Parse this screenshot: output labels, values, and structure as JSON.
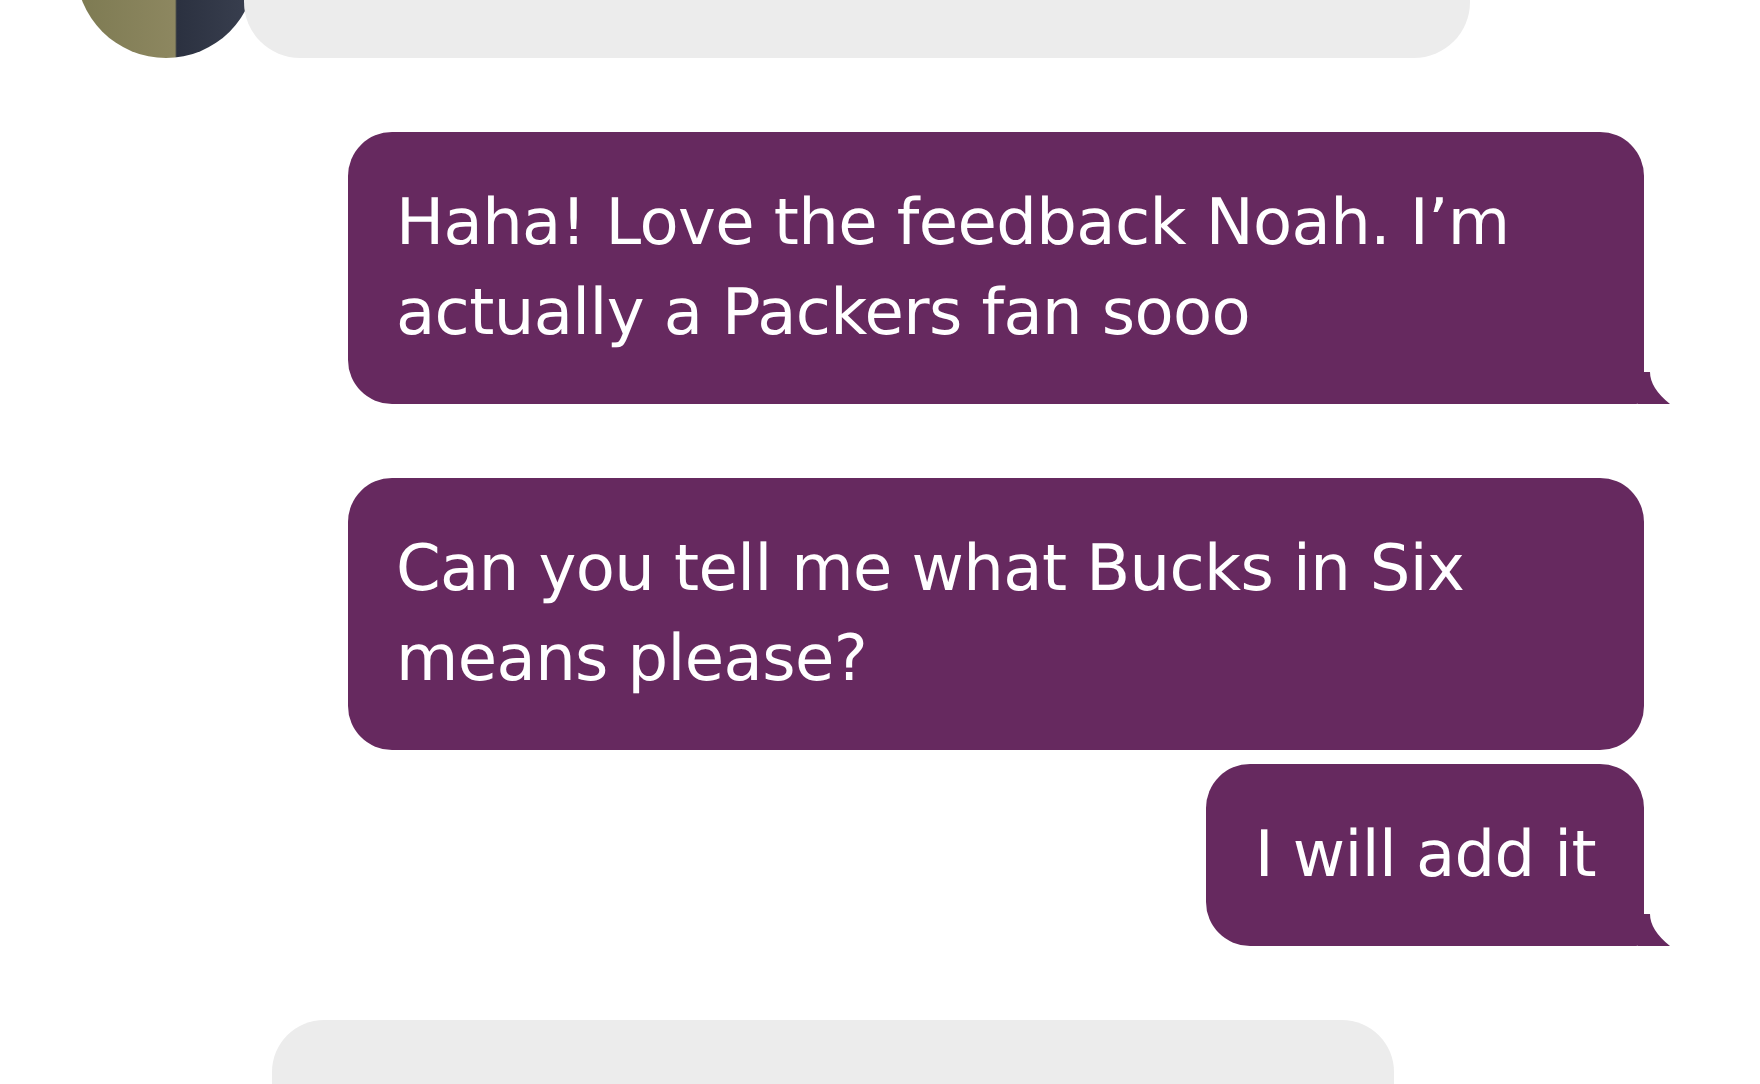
{
  "messages": [
    {
      "kind": "incoming",
      "avatar": true
    },
    {
      "kind": "outgoing",
      "text": "Haha! Love the feedback Noah. I’m actually a Packers fan sooo",
      "tail": true
    },
    {
      "kind": "outgoing",
      "text": "Can you tell me what Bucks in Six means please?",
      "tail": false
    },
    {
      "kind": "outgoing",
      "text": "I will add it",
      "tail": true
    },
    {
      "kind": "incoming"
    }
  ]
}
